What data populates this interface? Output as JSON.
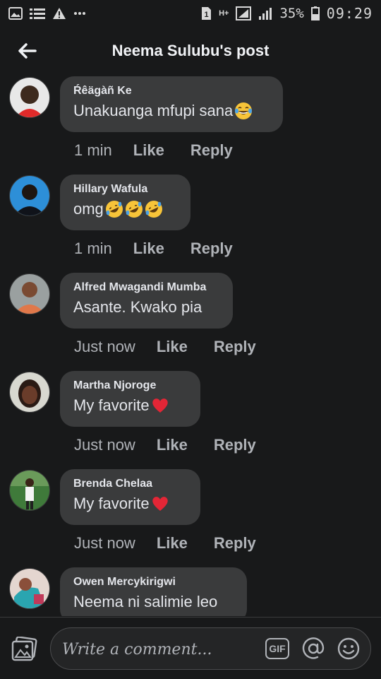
{
  "status_bar": {
    "sim_slot": "1",
    "network": "H+",
    "battery": "35%",
    "time": "09:29",
    "left_icons": [
      "image-icon",
      "list-icon",
      "warning-icon",
      "more-icon"
    ]
  },
  "header": {
    "title": "Neema Sulubu's post"
  },
  "comments": [
    {
      "author": "Ŕêägàñ Ke",
      "text": "Unakuanga mfupi sana",
      "emojis": [
        "laughing-tears"
      ],
      "time": "1 min",
      "like": "Like",
      "reply": "Reply"
    },
    {
      "author": "Hillary Wafula",
      "text": "omg",
      "emojis": [
        "rofl",
        "rofl",
        "rofl"
      ],
      "time": "1 min",
      "like": "Like",
      "reply": "Reply"
    },
    {
      "author": "Alfred Mwagandi Mumba",
      "text": "Asante. Kwako pia",
      "emojis": [],
      "time": "Just now",
      "like": "Like",
      "reply": "Reply"
    },
    {
      "author": "Martha Njoroge",
      "text": "My favorite ",
      "emojis": [
        "red-heart"
      ],
      "time": "Just now",
      "like": "Like",
      "reply": "Reply"
    },
    {
      "author": "Brenda Chelaa",
      "text": "My favorite ",
      "emojis": [
        "red-heart"
      ],
      "time": "Just now",
      "like": "Like",
      "reply": "Reply"
    },
    {
      "author": "Owen Mercykirigwi",
      "text": "Neema ni salimie leo",
      "emojis": [],
      "time": "",
      "like": "",
      "reply": ""
    }
  ],
  "composer": {
    "placeholder": "Write a comment...",
    "gif_label": "GIF"
  },
  "colors": {
    "background": "#18191a",
    "bubble": "#3a3b3c",
    "text_primary": "#e4e6eb",
    "text_secondary": "#b0b3b8"
  }
}
